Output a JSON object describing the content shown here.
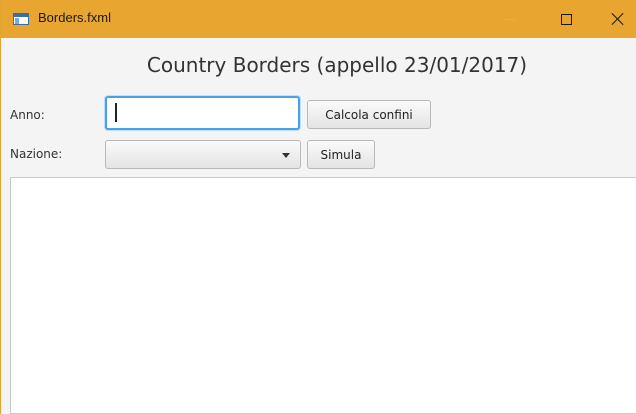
{
  "window": {
    "title": "Borders.fxml",
    "titlebar_color": "#e8a52f",
    "controls": {
      "minimize_icon": "minimize-icon",
      "maximize_icon": "maximize-icon",
      "close_icon": "close-icon"
    }
  },
  "page": {
    "title": "Country Borders (appello 23/01/2017)"
  },
  "form": {
    "anno_label": "Anno:",
    "anno_value": "",
    "calcola_label": "Calcola confini",
    "nazione_label": "Nazione:",
    "nazione_value": "",
    "simula_label": "Simula"
  },
  "output": {
    "text": ""
  }
}
